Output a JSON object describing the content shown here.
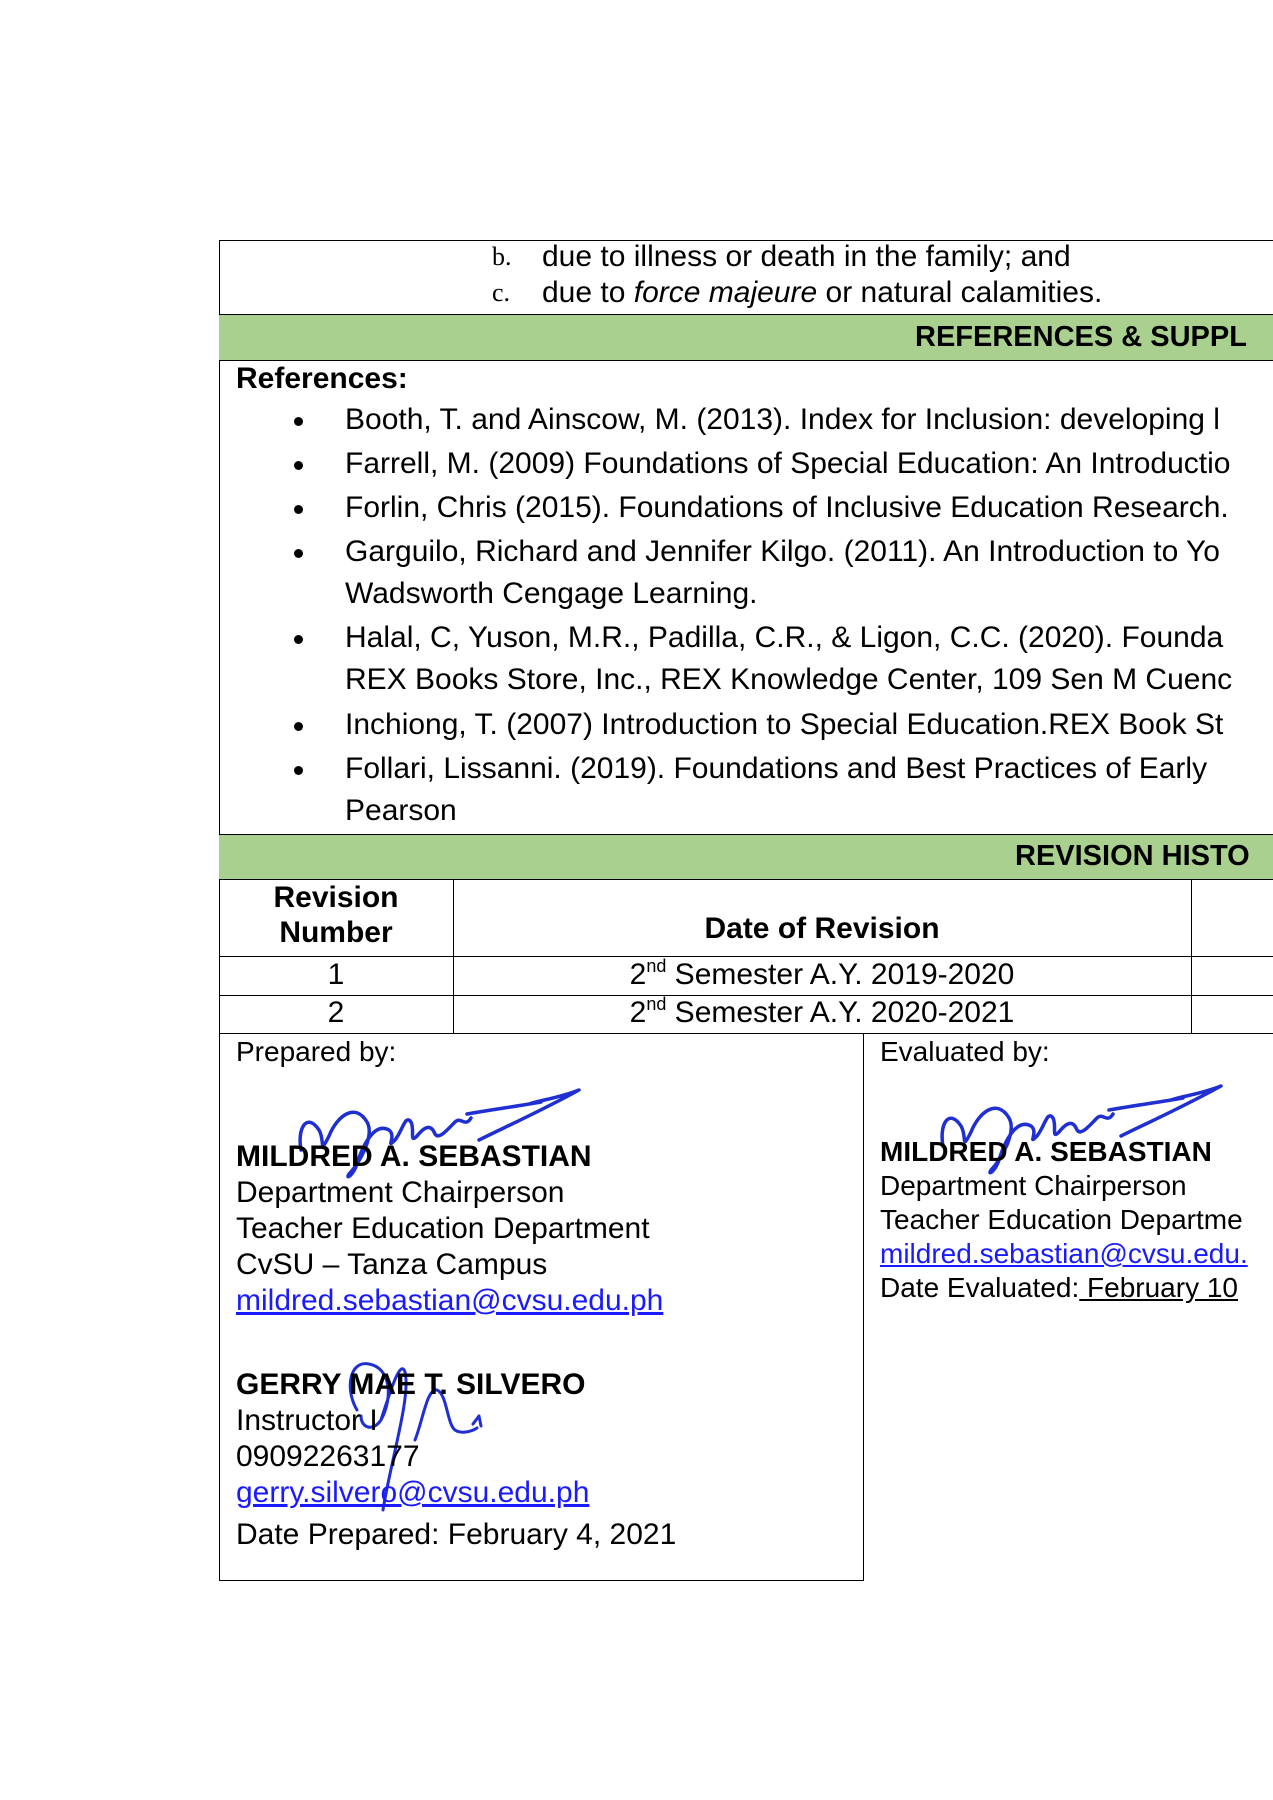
{
  "list_items": [
    {
      "label": "b.",
      "text_before": "due to illness or death in the family; and",
      "italic": "",
      "text_after": ""
    },
    {
      "label": "c.",
      "text_before": "due to ",
      "italic": "force majeure",
      "text_after": " or natural calamities."
    }
  ],
  "references_section": {
    "band_title": "REFERENCES & SUPPL",
    "heading": "References:",
    "items": [
      {
        "line1": "Booth, T. and Ainscow, M. (2013). Index for Inclusion: developing l",
        "line2": ""
      },
      {
        "line1": "Farrell, M. (2009) Foundations of Special Education: An Introductio",
        "line2": ""
      },
      {
        "line1": "Forlin, Chris (2015). Foundations of Inclusive Education Research.",
        "line2": ""
      },
      {
        "line1": "Garguilo, Richard and Jennifer Kilgo. (2011). An Introduction to Yo",
        "line2": "Wadsworth Cengage Learning."
      },
      {
        "line1": "Halal, C, Yuson, M.R., Padilla, C.R., & Ligon, C.C. (2020). Founda",
        "line2": "REX Books Store, Inc., REX Knowledge Center, 109 Sen M Cuenc"
      },
      {
        "line1": "Inchiong, T. (2007) Introduction to Special Education.REX Book St",
        "line2": ""
      },
      {
        "line1": "Follari, Lissanni. (2019).  Foundations and Best Practices of Early",
        "line2": "Pearson"
      }
    ]
  },
  "revision_history": {
    "band_title": "REVISION HISTO",
    "columns": [
      "Revision Number",
      "Date of Revision"
    ],
    "rows": [
      {
        "number": "1",
        "ordinal": "2",
        "sup": "nd",
        "rest": " Semester A.Y. 2019-2020"
      },
      {
        "number": "2",
        "ordinal": "2",
        "sup": "nd",
        "rest": " Semester A.Y. 2020-2021"
      }
    ]
  },
  "prepared": {
    "label": "Prepared by:",
    "person1": {
      "name": "MILDRED A. SEBASTIAN",
      "title": "Department Chairperson",
      "department": "Teacher Education Department",
      "campus": "CvSU – Tanza Campus",
      "email": "mildred.sebastian@cvsu.edu.ph"
    },
    "person2": {
      "name": "GERRY MAE T. SILVERO",
      "title": "Instructor I",
      "phone": "09092263177",
      "email": "gerry.silvero@cvsu.edu.ph"
    },
    "date_line": "Date Prepared: February 4, 2021"
  },
  "evaluated": {
    "label": "Evaluated by:",
    "name": "MILDRED A. SEBASTIAN",
    "title": "Department Chairperson",
    "department": "Teacher Education Departme",
    "email": "mildred.sebastian@cvsu.edu.",
    "date_label": "Date Evaluated:",
    "date_value": " February 10"
  },
  "colors": {
    "band": "#a9d08e",
    "link": "#1a1aff",
    "signature": "#1f2fd1"
  }
}
